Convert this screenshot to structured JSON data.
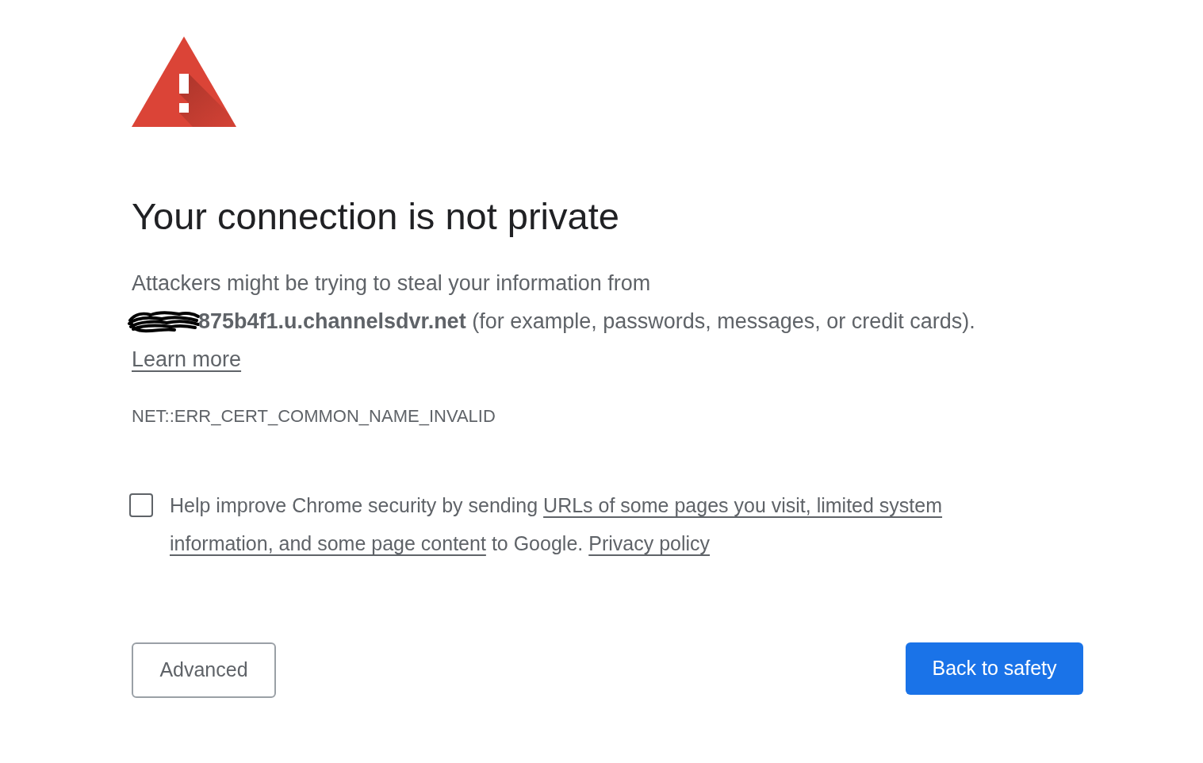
{
  "title": "Your connection is not private",
  "message": {
    "line_1": "Attackers might be trying to steal your information from",
    "line_2": "**875b4f1.u.channelsdvr.net** (for example, passwords, messages, or credit cards).",
    "link": "Learn more"
  },
  "error_code": "NET::ERR_CERT_COMMON_NAME_INVALID",
  "report_option": {
    "checked": false,
    "lines": [
      [
        {
          "kind": "text",
          "text": "Help improve Chrome security by sending"
        },
        {
          "kind": "link",
          "text": "URLs of some pages you visit, limited system"
        }
      ],
      [
        {
          "kind": "link",
          "text": "information, and some page content"
        },
        {
          "kind": "text",
          "text": "to Google."
        },
        {
          "kind": "link",
          "text": "Privacy policy"
        }
      ]
    ]
  },
  "buttons": {
    "secondary": "Advanced",
    "primary": "Back to safety"
  }
}
